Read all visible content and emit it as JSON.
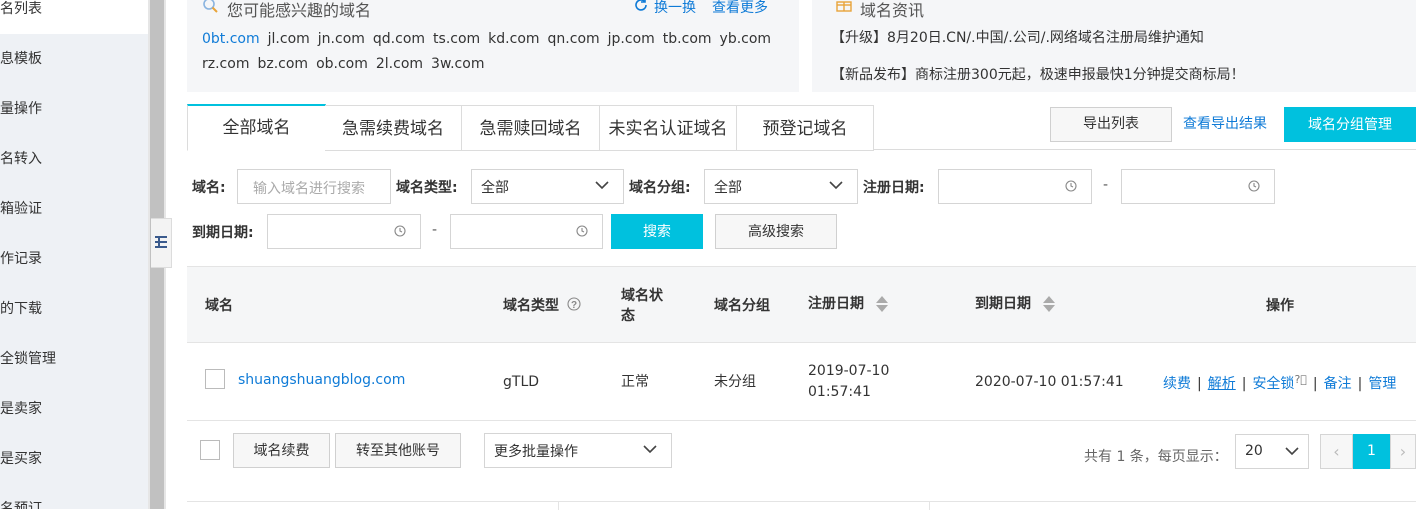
{
  "sidebar": {
    "items": [
      {
        "label": "名列表",
        "active": true
      },
      {
        "label": "息模板"
      },
      {
        "label": "量操作"
      },
      {
        "label": "名转入"
      },
      {
        "label": "箱验证"
      },
      {
        "label": "作记录"
      },
      {
        "label": "的下载"
      },
      {
        "label": "全锁管理"
      },
      {
        "label": "是卖家"
      },
      {
        "label": "是买家"
      },
      {
        "label": "名预订"
      }
    ]
  },
  "interest_card": {
    "title": "您可能感兴趣的域名",
    "refresh_label": "换一换",
    "more_label": "查看更多",
    "domains": [
      "0bt.com",
      "jl.com",
      "jn.com",
      "qd.com",
      "ts.com",
      "kd.com",
      "qn.com",
      "jp.com",
      "tb.com",
      "yb.com",
      "rz.com",
      "bz.com",
      "ob.com",
      "2l.com",
      "3w.com"
    ]
  },
  "news_card": {
    "title": "域名资讯",
    "items": [
      "【升级】8月20日.CN/.中国/.公司/.网络域名注册局维护通知",
      "【新品发布】商标注册300元起，极速申报最快1分钟提交商标局！"
    ]
  },
  "tabs": [
    "全部域名",
    "急需续费域名",
    "急需赎回域名",
    "未实名认证域名",
    "预登记域名"
  ],
  "toolbar": {
    "export_label": "导出列表",
    "view_export_label": "查看导出结果",
    "group_manage_label": "域名分组管理"
  },
  "filters": {
    "domain_label": "域名:",
    "domain_placeholder": "输入域名进行搜索",
    "type_label": "域名类型:",
    "type_value": "全部",
    "group_label": "域名分组:",
    "group_value": "全部",
    "reg_date_label": "注册日期:",
    "expire_date_label": "到期日期:",
    "range_sep": "-",
    "search_label": "搜索",
    "advanced_label": "高级搜索"
  },
  "table": {
    "headers": {
      "domain": "域名",
      "type": "域名类型",
      "status": "域名状态",
      "group": "域名分组",
      "reg_date": "注册日期",
      "expire_date": "到期日期",
      "actions": "操作"
    },
    "rows": [
      {
        "domain": "shuangshuangblog.com",
        "type": "gTLD",
        "status": "正常",
        "group": "未分组",
        "reg_date_line1": "2019-07-10",
        "reg_date_line2": "01:57:41",
        "expire_date": "2020-07-10 01:57:41",
        "actions": [
          "续费",
          "解析",
          "安全锁",
          "备注",
          "管理"
        ]
      }
    ]
  },
  "footer": {
    "renew_label": "域名续费",
    "transfer_label": "转至其他账号",
    "batch_label": "更多批量操作",
    "summary": "共有 1 条，每页显示：",
    "page_size": "20",
    "prev": "‹",
    "next": "›",
    "current_page": "1"
  },
  "colors": {
    "accent": "#00c1de",
    "link": "#0f7bd7",
    "sidebar_bg": "#eef1f5",
    "card_bg": "#f5f6f8"
  }
}
